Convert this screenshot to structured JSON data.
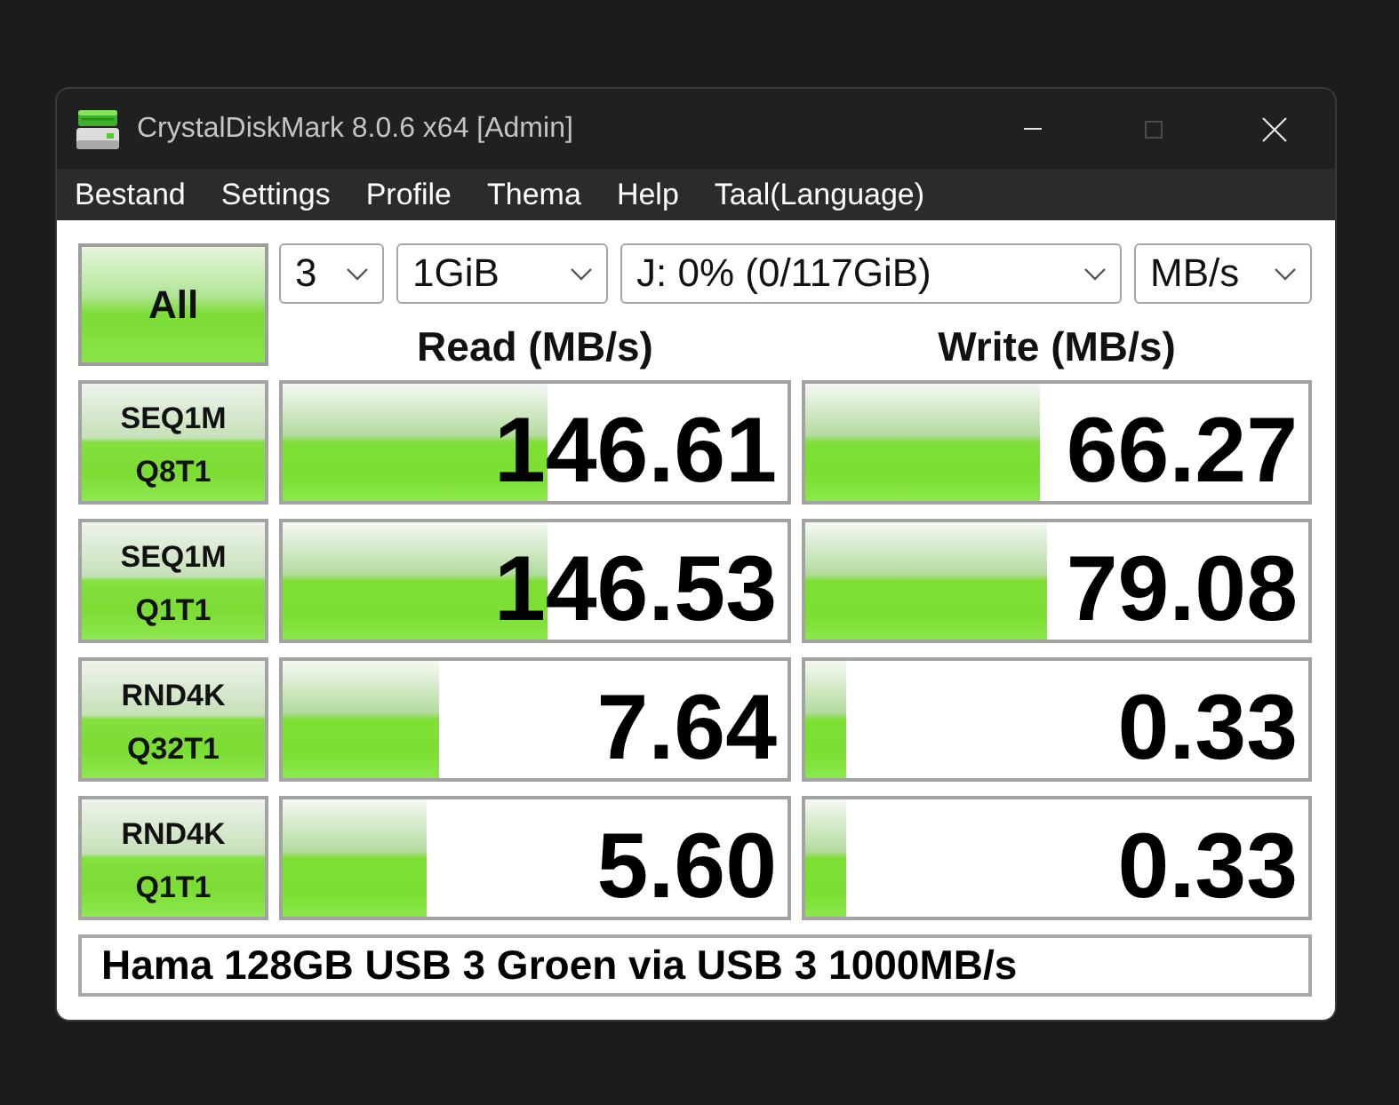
{
  "window": {
    "title": "CrystalDiskMark 8.0.6 x64 [Admin]",
    "maximize_disabled": true
  },
  "menu": [
    "Bestand",
    "Settings",
    "Profile",
    "Thema",
    "Help",
    "Taal(Language)"
  ],
  "controls": {
    "run_all": "All",
    "dropdowns": [
      "3",
      "1GiB",
      "J: 0% (0/117GiB)",
      "MB/s"
    ]
  },
  "columns": [
    "Read (MB/s)",
    "Write (MB/s)"
  ],
  "tests": [
    {
      "name": "SEQ1M",
      "params": "Q8T1",
      "read": {
        "value": "146.61",
        "level": 0.525
      },
      "write": {
        "value": "66.27",
        "level": 0.467
      }
    },
    {
      "name": "SEQ1M",
      "params": "Q1T1",
      "read": {
        "value": "146.53",
        "level": 0.525
      },
      "write": {
        "value": "79.08",
        "level": 0.48
      }
    },
    {
      "name": "RND4K",
      "params": "Q32T1",
      "read": {
        "value": "7.64",
        "level": 0.31
      },
      "write": {
        "value": "0.33",
        "level": 0.08
      }
    },
    {
      "name": "RND4K",
      "params": "Q1T1",
      "read": {
        "value": "5.60",
        "level": 0.285
      },
      "write": {
        "value": "0.33",
        "level": 0.08
      }
    }
  ],
  "comment": "Hama 128GB USB 3 Groen via USB 3 1000MB/s"
}
